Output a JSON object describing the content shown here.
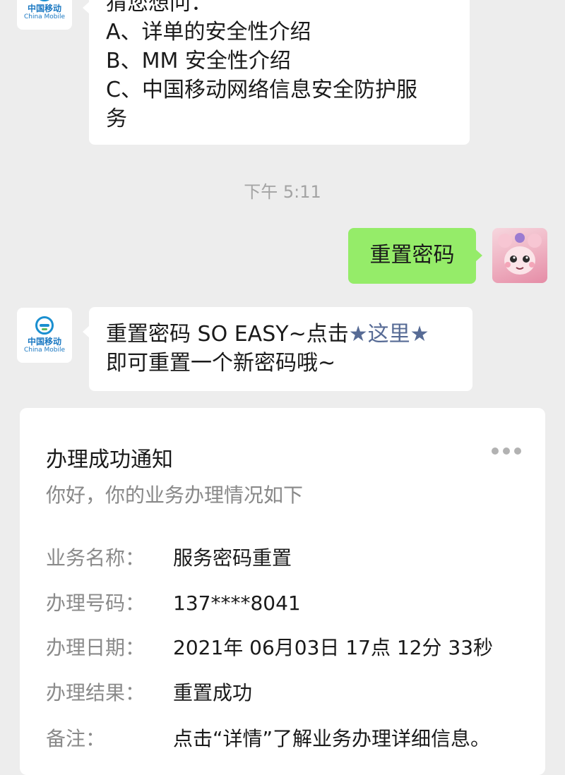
{
  "chat": {
    "bot_name_cn": "中国移动",
    "bot_name_en": "China Mobile",
    "message1_lines": [
      "猜您想问：",
      "A、详单的安全性介绍",
      "B、MM 安全性介绍",
      "C、中国移动网络信息安全防护服",
      "务"
    ],
    "timestamp": "下午 5:11",
    "user_message": "重置密码",
    "message2": {
      "prefix": "重置密码 SO EASY~点击",
      "link": "★这里★",
      "suffix": "即可重置一个新密码哦~"
    }
  },
  "card": {
    "title": "办理成功通知",
    "subtitle": "你好，你的业务办理情况如下",
    "rows": [
      {
        "label": "业务名称：",
        "value": "服务密码重置"
      },
      {
        "label": "办理号码：",
        "value": "137****8041"
      },
      {
        "label": "办理日期：",
        "value": "2021年 06月03日 17点 12分 33秒"
      },
      {
        "label": "办理结果：",
        "value": "重置成功"
      },
      {
        "label": "备注：",
        "value": "点击“详情”了解业务办理详细信息。"
      }
    ]
  },
  "colors": {
    "background": "#ededed",
    "bubble_self": "#95ec69",
    "link": "#576b95",
    "brand": "#1a78c2"
  },
  "icons": {
    "bot_avatar": "china-mobile-logo",
    "user_avatar": "anime-girl-avatar",
    "card_more": "more-dots-icon"
  }
}
